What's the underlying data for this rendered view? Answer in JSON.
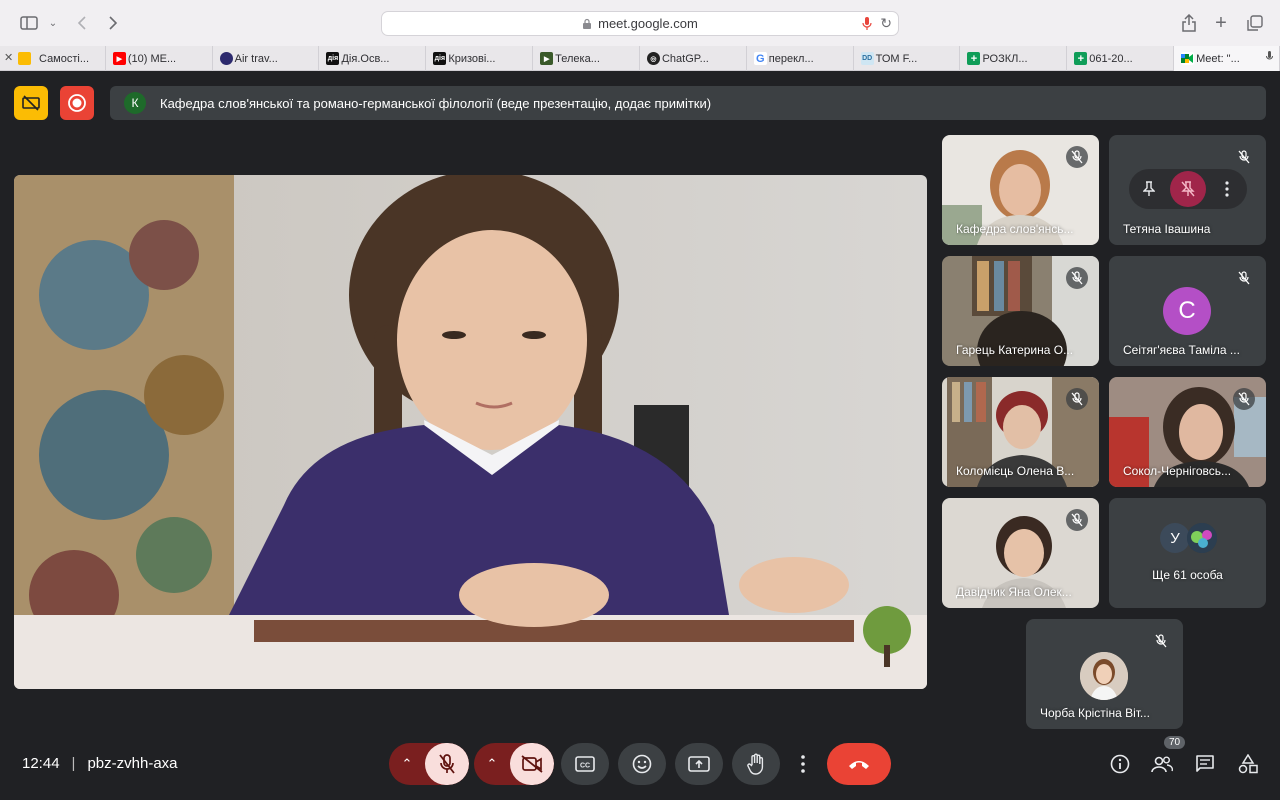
{
  "browser": {
    "url": "meet.google.com",
    "tabs": [
      {
        "label": "Самості...",
        "color": "#fbbc04",
        "icon": "classroom-icon",
        "glyph": ""
      },
      {
        "label": "(10) ME...",
        "color": "#ff0000",
        "icon": "youtube-icon",
        "glyph": "▶"
      },
      {
        "label": "Air trav...",
        "color": "#2d2a6e",
        "icon": "app-icon",
        "glyph": ""
      },
      {
        "label": "Дія.Осв...",
        "color": "#111111",
        "icon": "diia-icon",
        "glyph": "дія"
      },
      {
        "label": "Кризові...",
        "color": "#111111",
        "icon": "diia-icon",
        "glyph": "дія"
      },
      {
        "label": "Телека...",
        "color": "#3a5a2a",
        "icon": "tv-icon",
        "glyph": "▶"
      },
      {
        "label": "ChatGP...",
        "color": "#222222",
        "icon": "chatgpt-icon",
        "glyph": "◎"
      },
      {
        "label": "перекл...",
        "color": "#ffffff",
        "icon": "google-icon",
        "glyph": "G"
      },
      {
        "label": "ТОМ F...",
        "color": "#cfe6f3",
        "icon": "doc-icon",
        "glyph": "DD"
      },
      {
        "label": "РОЗКЛ...",
        "color": "#0f9d58",
        "icon": "sheets-icon",
        "glyph": "+"
      },
      {
        "label": "061-20...",
        "color": "#0f9d58",
        "icon": "sheets-icon",
        "glyph": "+"
      },
      {
        "label": "Meet: \"...",
        "color": "#ffffff",
        "icon": "meet-icon",
        "glyph": ""
      }
    ]
  },
  "meeting": {
    "presenter_initial": "К",
    "presenter_text": "Кафедра слов'янської та романо-германської філології (веде презентацію, додає примітки)",
    "time": "12:44",
    "code": "pbz-zvhh-axa",
    "participant_count": "70"
  },
  "tiles": {
    "t1": {
      "name": "Кафедра слов'янсь..."
    },
    "t2": {
      "name": "Тетяна Івашина"
    },
    "t3": {
      "name": "Гарець Катерина О..."
    },
    "t4": {
      "name": "Сеітяг'яєва Таміла ...",
      "initial": "С",
      "color": "#b44fc6"
    },
    "t5": {
      "name": "Коломієць Олена В..."
    },
    "t6": {
      "name": "Сокол-Черніговсь..."
    },
    "t7": {
      "name": "Давідчик Яна Олек..."
    },
    "t8": {
      "name": "Ще 61 особа",
      "initial": "У"
    },
    "t9": {
      "name": "Чорба Крістіна Віт..."
    }
  },
  "colors": {
    "background": "#202124",
    "tile": "#3c4043",
    "end_call": "#ea4335",
    "muted_control": "#f9dedc",
    "warning_yellow": "#fbbc04",
    "record_red": "#ea4335"
  }
}
